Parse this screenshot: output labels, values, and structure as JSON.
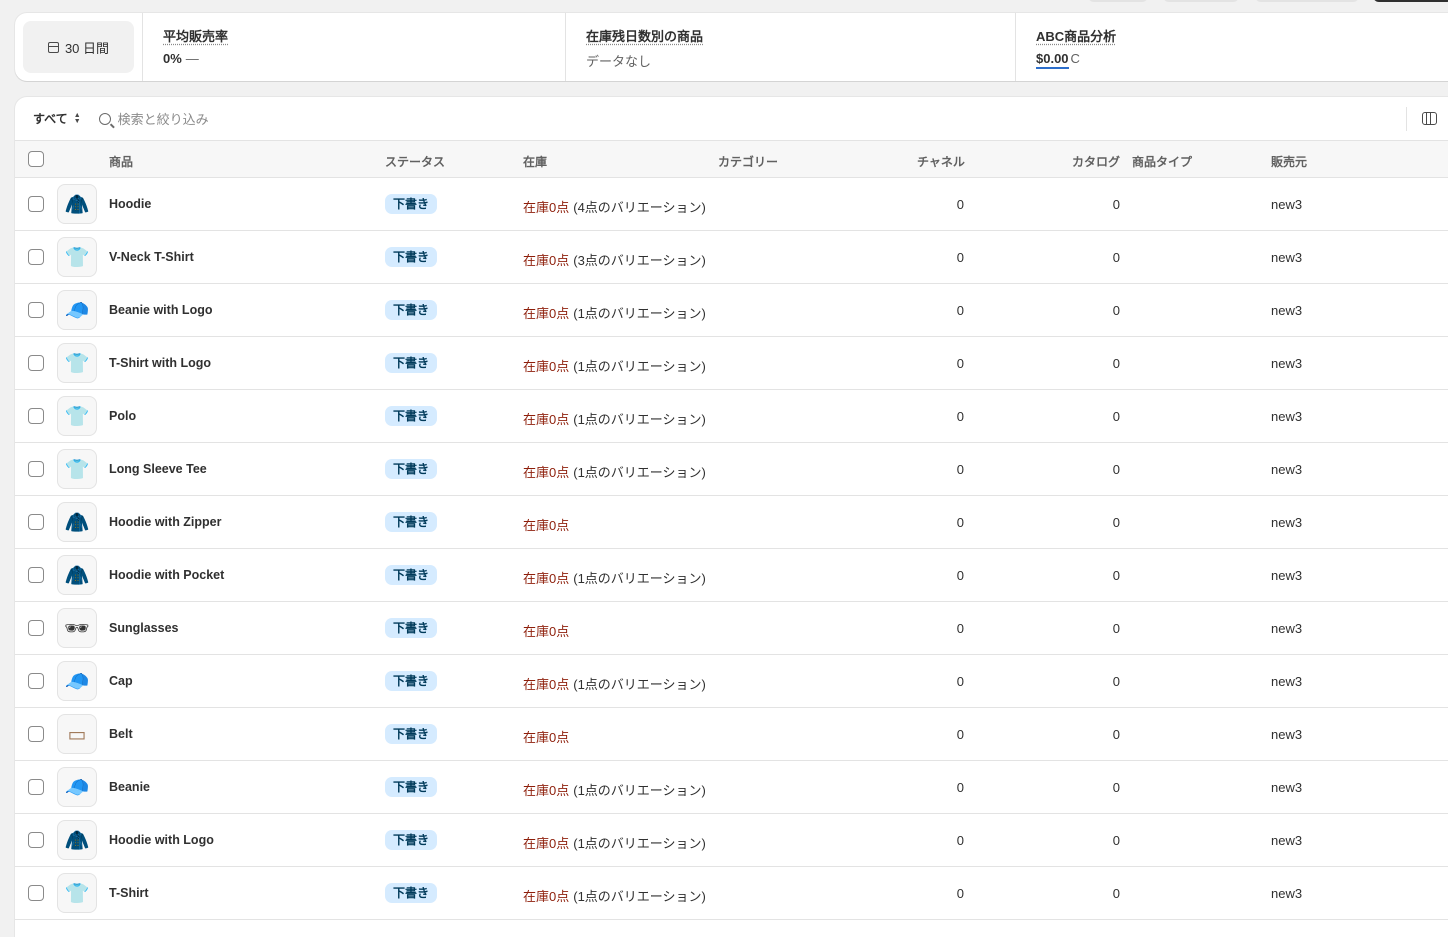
{
  "metrics": {
    "period_label": "30 日間",
    "sell_through": {
      "title": "平均販売率",
      "value": "0%",
      "trend": "—"
    },
    "days_of_inventory": {
      "title": "在庫残日数別の商品",
      "value": "データなし"
    },
    "abc_analysis": {
      "title": "ABC商品分析",
      "value": "$0.00",
      "suffix": "C"
    }
  },
  "toolbar": {
    "view_label": "すべて",
    "search_placeholder": "検索と絞り込み"
  },
  "columns": {
    "product": "商品",
    "status": "ステータス",
    "inventory": "在庫",
    "category": "カテゴリー",
    "channels": "チャネル",
    "catalogs": "カタログ",
    "product_type": "商品タイプ",
    "vendor": "販売元"
  },
  "products": [
    {
      "name": "Hoodie",
      "status": "下書き",
      "stock": "在庫0点",
      "variants": "(4点のバリエーション)",
      "channels": "0",
      "catalogs": "0",
      "vendor": "new3",
      "thumb_icon": "hoodie-icon",
      "thumb_color": "#f08a6c"
    },
    {
      "name": "V-Neck T-Shirt",
      "status": "下書き",
      "stock": "在庫0点",
      "variants": "(3点のバリエーション)",
      "channels": "0",
      "catalogs": "0",
      "vendor": "new3",
      "thumb_icon": "tshirt-icon",
      "thumb_color": "#f08a6c"
    },
    {
      "name": "Beanie with Logo",
      "status": "下書き",
      "stock": "在庫0点",
      "variants": "(1点のバリエーション)",
      "channels": "0",
      "catalogs": "0",
      "vendor": "new3",
      "thumb_icon": "beanie-icon",
      "thumb_color": "#8fb9d9"
    },
    {
      "name": "T-Shirt with Logo",
      "status": "下書き",
      "stock": "在庫0点",
      "variants": "(1点のバリエーション)",
      "channels": "0",
      "catalogs": "0",
      "vendor": "new3",
      "thumb_icon": "tshirt-icon",
      "thumb_color": "#8ad6bd"
    },
    {
      "name": "Polo",
      "status": "下書き",
      "stock": "在庫0点",
      "variants": "(1点のバリエーション)",
      "channels": "0",
      "catalogs": "0",
      "vendor": "new3",
      "thumb_icon": "polo-icon",
      "thumb_color": "#8fb9d9"
    },
    {
      "name": "Long Sleeve Tee",
      "status": "下書き",
      "stock": "在庫0点",
      "variants": "(1点のバリエーション)",
      "channels": "0",
      "catalogs": "0",
      "vendor": "new3",
      "thumb_icon": "longsleeve-icon",
      "thumb_color": "#8ad6bd"
    },
    {
      "name": "Hoodie with Zipper",
      "status": "下書き",
      "stock": "在庫0点",
      "variants": "",
      "channels": "0",
      "catalogs": "0",
      "vendor": "new3",
      "thumb_icon": "hoodie-icon",
      "thumb_color": "#8ad6bd"
    },
    {
      "name": "Hoodie with Pocket",
      "status": "下書き",
      "stock": "在庫0点",
      "variants": "(1点のバリエーション)",
      "channels": "0",
      "catalogs": "0",
      "vendor": "new3",
      "thumb_icon": "hoodie-icon",
      "thumb_color": "#b3b3b3"
    },
    {
      "name": "Sunglasses",
      "status": "下書き",
      "stock": "在庫0点",
      "variants": "",
      "channels": "0",
      "catalogs": "0",
      "vendor": "new3",
      "thumb_icon": "sunglasses-icon",
      "thumb_color": "#333333"
    },
    {
      "name": "Cap",
      "status": "下書き",
      "stock": "在庫0点",
      "variants": "(1点のバリエーション)",
      "channels": "0",
      "catalogs": "0",
      "vendor": "new3",
      "thumb_icon": "cap-icon",
      "thumb_color": "#f2d28a"
    },
    {
      "name": "Belt",
      "status": "下書き",
      "stock": "在庫0点",
      "variants": "",
      "channels": "0",
      "catalogs": "0",
      "vendor": "new3",
      "thumb_icon": "belt-icon",
      "thumb_color": "#a07a5a"
    },
    {
      "name": "Beanie",
      "status": "下書き",
      "stock": "在庫0点",
      "variants": "(1点のバリエーション)",
      "channels": "0",
      "catalogs": "0",
      "vendor": "new3",
      "thumb_icon": "beanie-icon",
      "thumb_color": "#f08a6c"
    },
    {
      "name": "Hoodie with Logo",
      "status": "下書き",
      "stock": "在庫0点",
      "variants": "(1点のバリエーション)",
      "channels": "0",
      "catalogs": "0",
      "vendor": "new3",
      "thumb_icon": "hoodie-icon",
      "thumb_color": "#8fb9d9"
    },
    {
      "name": "T-Shirt",
      "status": "下書き",
      "stock": "在庫0点",
      "variants": "(1点のバリエーション)",
      "channels": "0",
      "catalogs": "0",
      "vendor": "new3",
      "thumb_icon": "tshirt-icon",
      "thumb_color": "#cfcfcf"
    }
  ]
}
